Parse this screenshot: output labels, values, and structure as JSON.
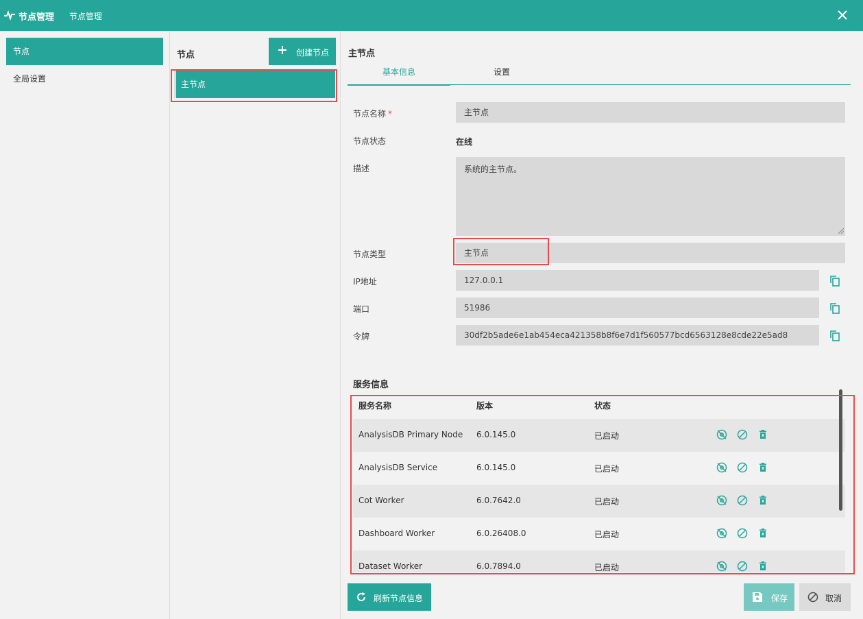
{
  "titlebar": {
    "app_title": "节点管理",
    "sub_title": "节点管理"
  },
  "nav": {
    "items": [
      {
        "label": "节点"
      },
      {
        "label": "全局设置"
      }
    ]
  },
  "nodes": {
    "header": "节点",
    "create_label": "创建节点",
    "items": [
      {
        "label": "主节点"
      }
    ]
  },
  "detail": {
    "header": "主节点",
    "tabs": [
      {
        "label": "基本信息"
      },
      {
        "label": "设置"
      }
    ],
    "form": {
      "name_label": "节点名称",
      "required_mark": "*",
      "name_value": "主节点",
      "status_label": "节点状态",
      "status_value": "在线",
      "desc_label": "描述",
      "desc_value": "系统的主节点。",
      "type_label": "节点类型",
      "type_value": "主节点",
      "ip_label": "IP地址",
      "ip_value": "127.0.0.1",
      "port_label": "端口",
      "port_value": "51986",
      "token_label": "令牌",
      "token_value": "30df2b5ade6e1ab454eca421358b8f6e7d1f560577bcd6563128e8cde22e5ad8"
    },
    "services": {
      "title": "服务信息",
      "columns": [
        "服务名称",
        "版本",
        "状态"
      ],
      "rows": [
        {
          "name": "AnalysisDB Primary Node",
          "version": "6.0.145.0",
          "status": "已启动"
        },
        {
          "name": "AnalysisDB Service",
          "version": "6.0.145.0",
          "status": "已启动"
        },
        {
          "name": "Cot Worker",
          "version": "6.0.7642.0",
          "status": "已启动"
        },
        {
          "name": "Dashboard Worker",
          "version": "6.0.26408.0",
          "status": "已启动"
        },
        {
          "name": "Dataset Worker",
          "version": "6.0.7894.0",
          "status": "已启动"
        }
      ]
    },
    "buttons": {
      "refresh": "刷新节点信息",
      "save": "保存",
      "cancel": "取消"
    }
  },
  "colors": {
    "accent": "#26a69a",
    "accent_light": "#76c9c0",
    "highlight": "#e74c4c"
  }
}
